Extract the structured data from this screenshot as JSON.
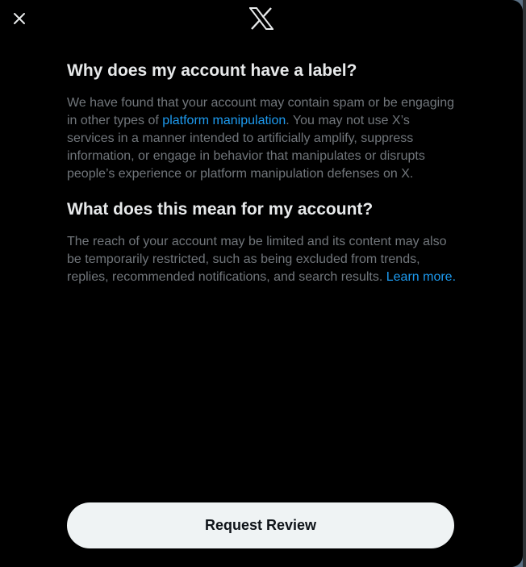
{
  "header": {
    "close_icon": "close-icon",
    "logo_icon": "x-logo-icon"
  },
  "section1": {
    "title": "Why does my account have a label?",
    "text_before": "We have found that your account may contain spam or be engaging in other types of ",
    "link": "platform manipulation",
    "text_after": ". You may not use X’s services in a manner intended to artificially amplify, suppress information, or engage in behavior that manipulates or disrupts people’s experience or platform manipulation defenses on X."
  },
  "section2": {
    "title": "What does this mean for my account?",
    "text": "The reach of your account may be limited and its content may also be temporarily restricted, such as being excluded from trends, replies, recommended notifications, and search results. ",
    "link": "Learn more."
  },
  "footer": {
    "button_label": "Request Review"
  },
  "colors": {
    "background": "#000000",
    "heading": "#e7e9ea",
    "body_text": "#71767b",
    "link": "#1d9bf0",
    "button_bg": "#eff3f4",
    "button_text": "#0f1419"
  }
}
